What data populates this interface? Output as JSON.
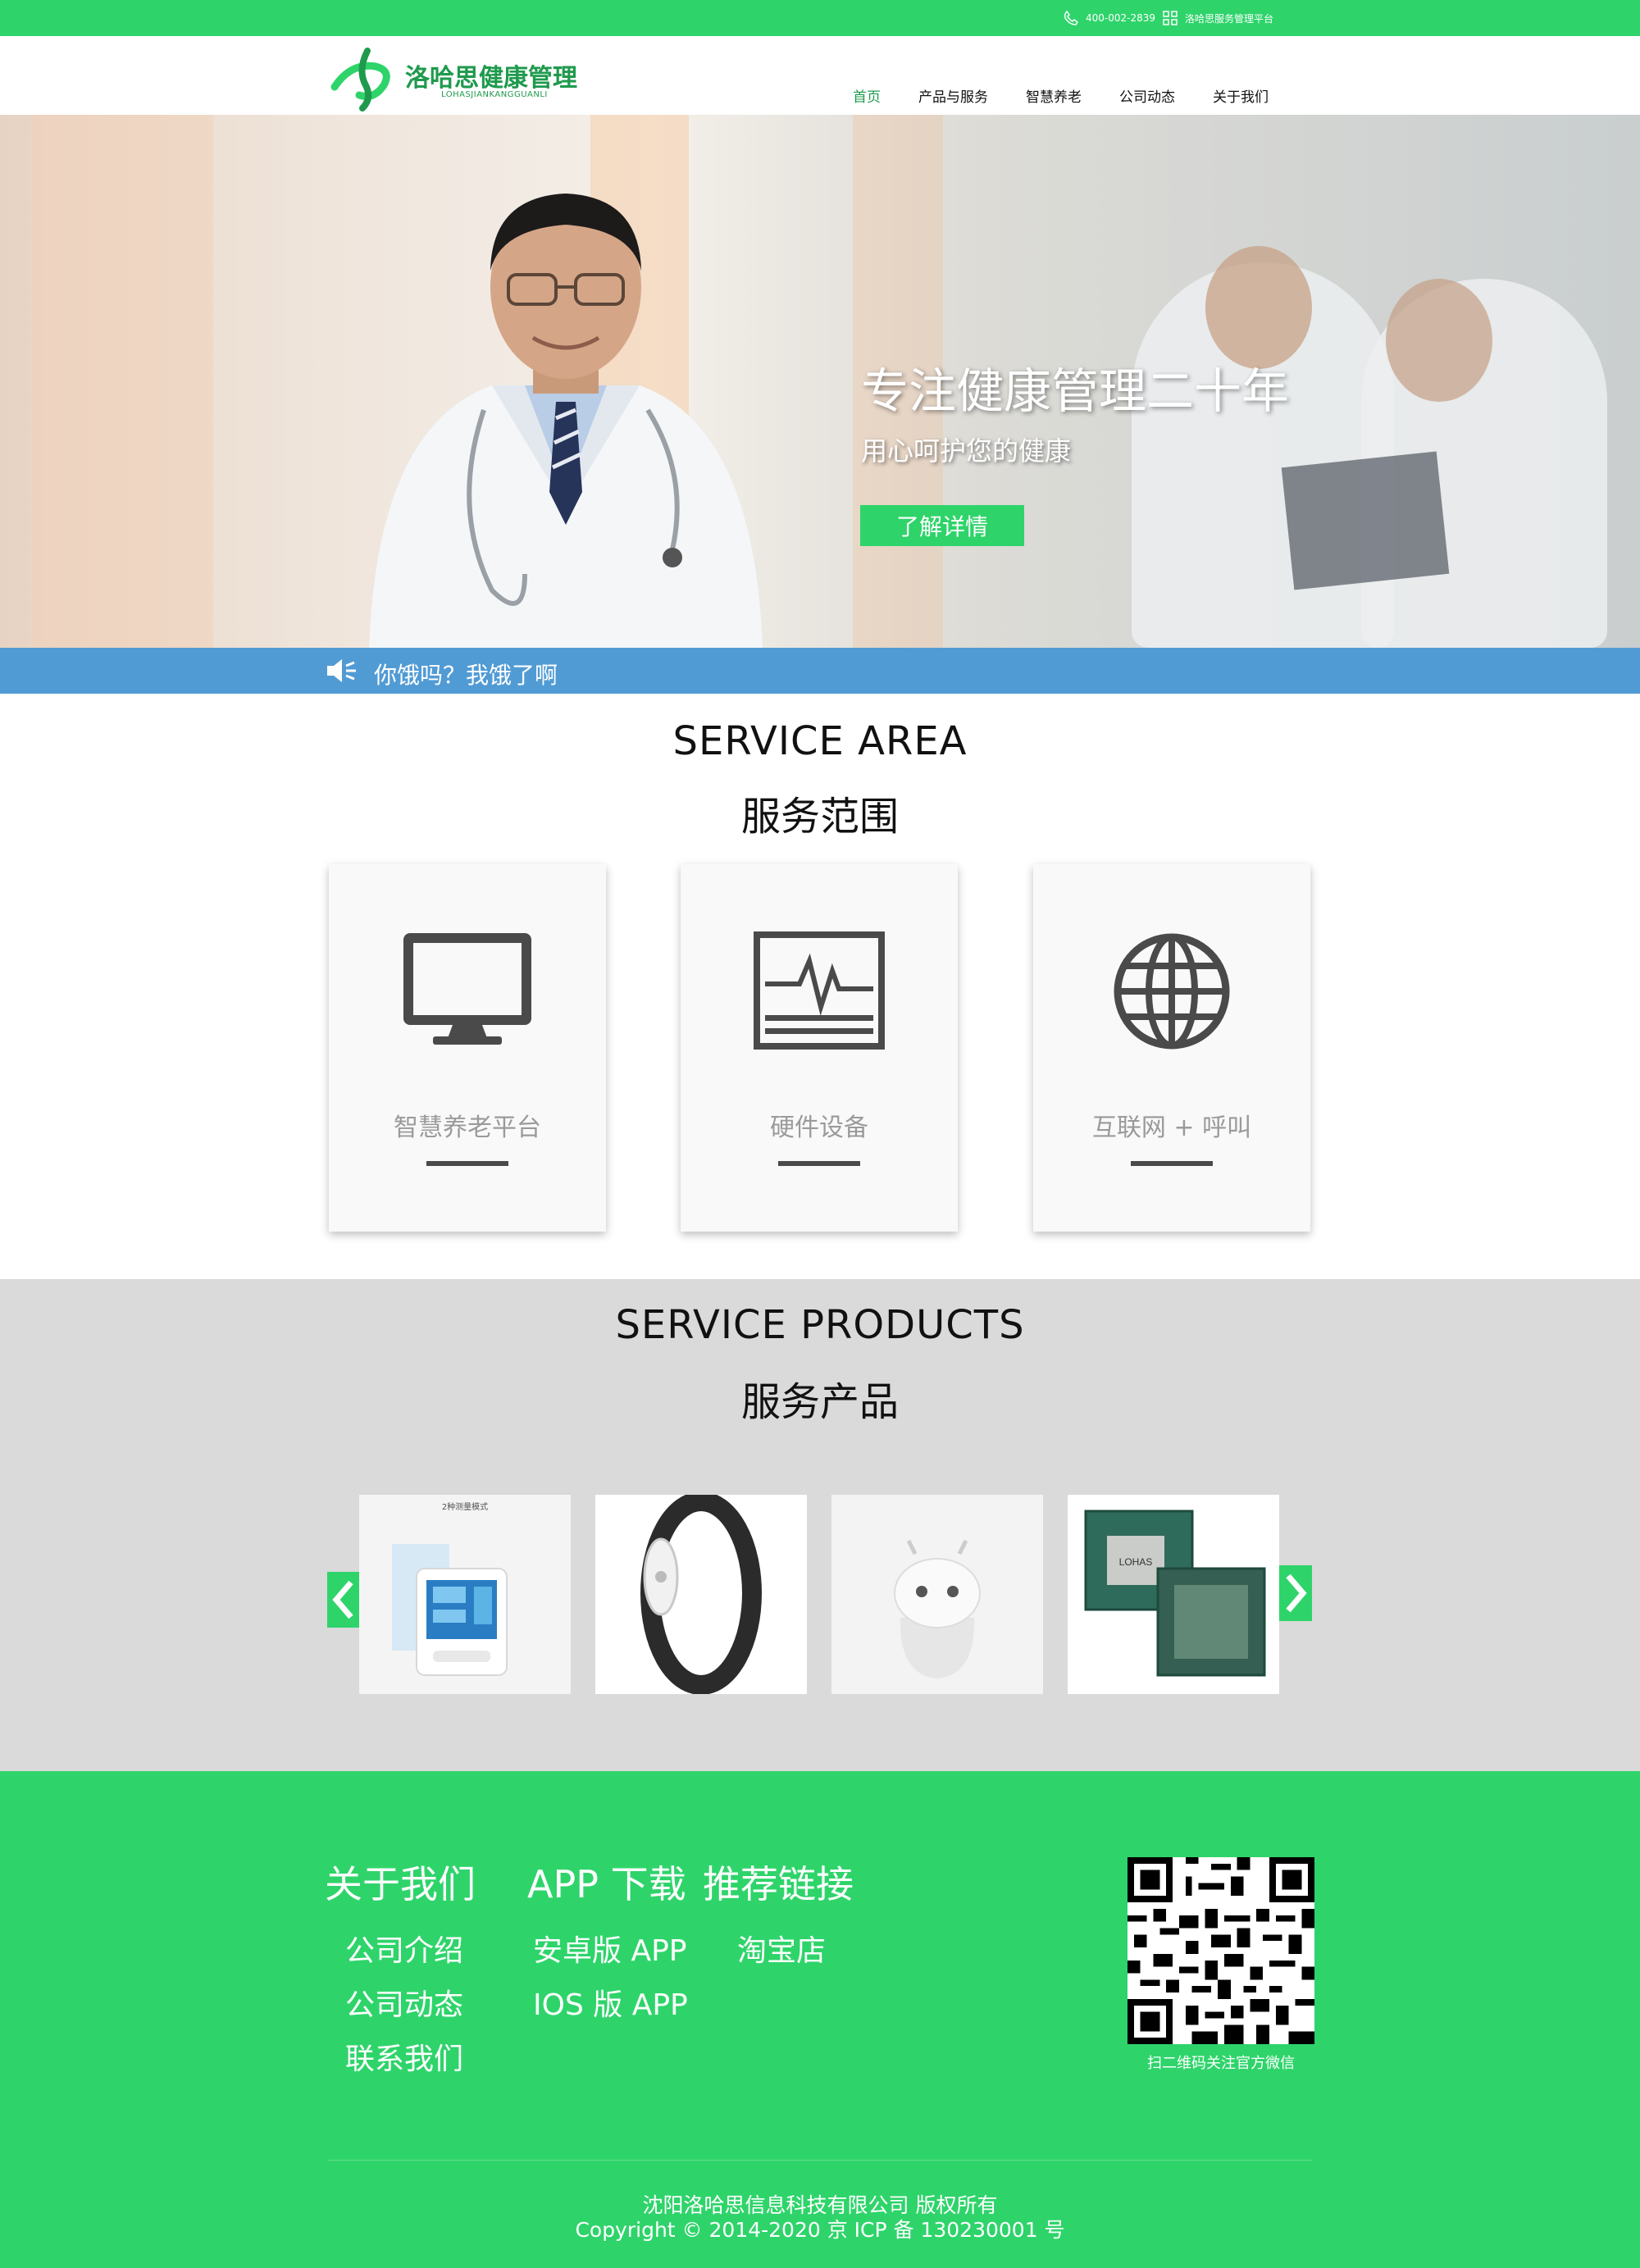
{
  "topbar": {
    "phone": "400-002-2839",
    "platform": "洛哈思服务管理平台"
  },
  "header": {
    "logo_title": "洛哈思健康管理",
    "logo_sub": "LOHASJIANKANGGUANLI",
    "nav": [
      "首页",
      "产品与服务",
      "智慧养老",
      "公司动态",
      "关于我们"
    ],
    "active_nav": "首页"
  },
  "hero": {
    "title": "专注健康管理二十年",
    "subtitle": "用心呵护您的健康",
    "button": "了解详情"
  },
  "notice": {
    "icon": "speaker-icon",
    "text": "你饿吗？我饿了啊"
  },
  "service_area": {
    "title_en": "SERVICE AREA",
    "title_cn": "服务范围",
    "cards": [
      {
        "label": "智慧养老平台",
        "icon": "monitor-icon"
      },
      {
        "label": "硬件设备",
        "icon": "ecg-monitor-icon"
      },
      {
        "label": "互联网 + 呼叫",
        "icon": "globe-icon"
      }
    ]
  },
  "service_products": {
    "title_en": "SERVICE  PRODUCTS",
    "title_cn": "服务产品",
    "products": [
      {
        "name": "blood-pressure-monitor",
        "caption": "2种测量模式"
      },
      {
        "name": "smart-wristband"
      },
      {
        "name": "robot-speaker"
      },
      {
        "name": "chip-board",
        "chip_text": "LOHAS"
      }
    ]
  },
  "footer": {
    "headings": [
      "关于我们",
      "APP 下载",
      "推荐链接"
    ],
    "about_links": [
      "公司介绍",
      "公司动态",
      "联系我们"
    ],
    "app_links": [
      "安卓版 APP",
      "IOS 版 APP"
    ],
    "recommend_links": [
      "淘宝店"
    ],
    "qr_text": "扫二维码关注官方微信",
    "copyright_line1": "沈阳洛哈思信息科技有限公司  版权所有",
    "copyright_line2": "Copyright © 2014-2020 京 ICP 备 130230001 号"
  },
  "colors": {
    "brand_green": "#2ed46a",
    "logo_green": "#1f9a4d",
    "notice_blue": "#519bd5",
    "products_bg": "#dadada"
  }
}
